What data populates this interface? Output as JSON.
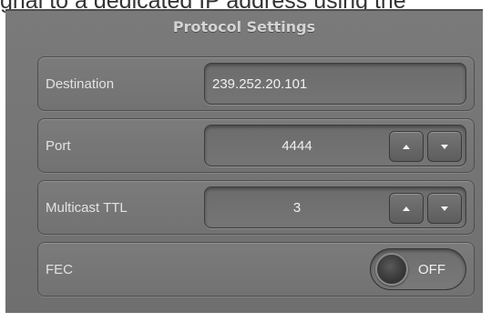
{
  "top_caption": "gnal to a dedicated IP address using the",
  "panel": {
    "title": "Protocol Settings"
  },
  "rows": {
    "destination": {
      "label": "Destination",
      "value": "239.252.20.101"
    },
    "port": {
      "label": "Port",
      "value": "4444"
    },
    "ttl": {
      "label": "Multicast TTL",
      "value": "3"
    },
    "fec": {
      "label": "FEC",
      "state": "OFF"
    }
  },
  "icons": {
    "increment": "chevron-up-icon",
    "decrement": "chevron-down-icon"
  }
}
